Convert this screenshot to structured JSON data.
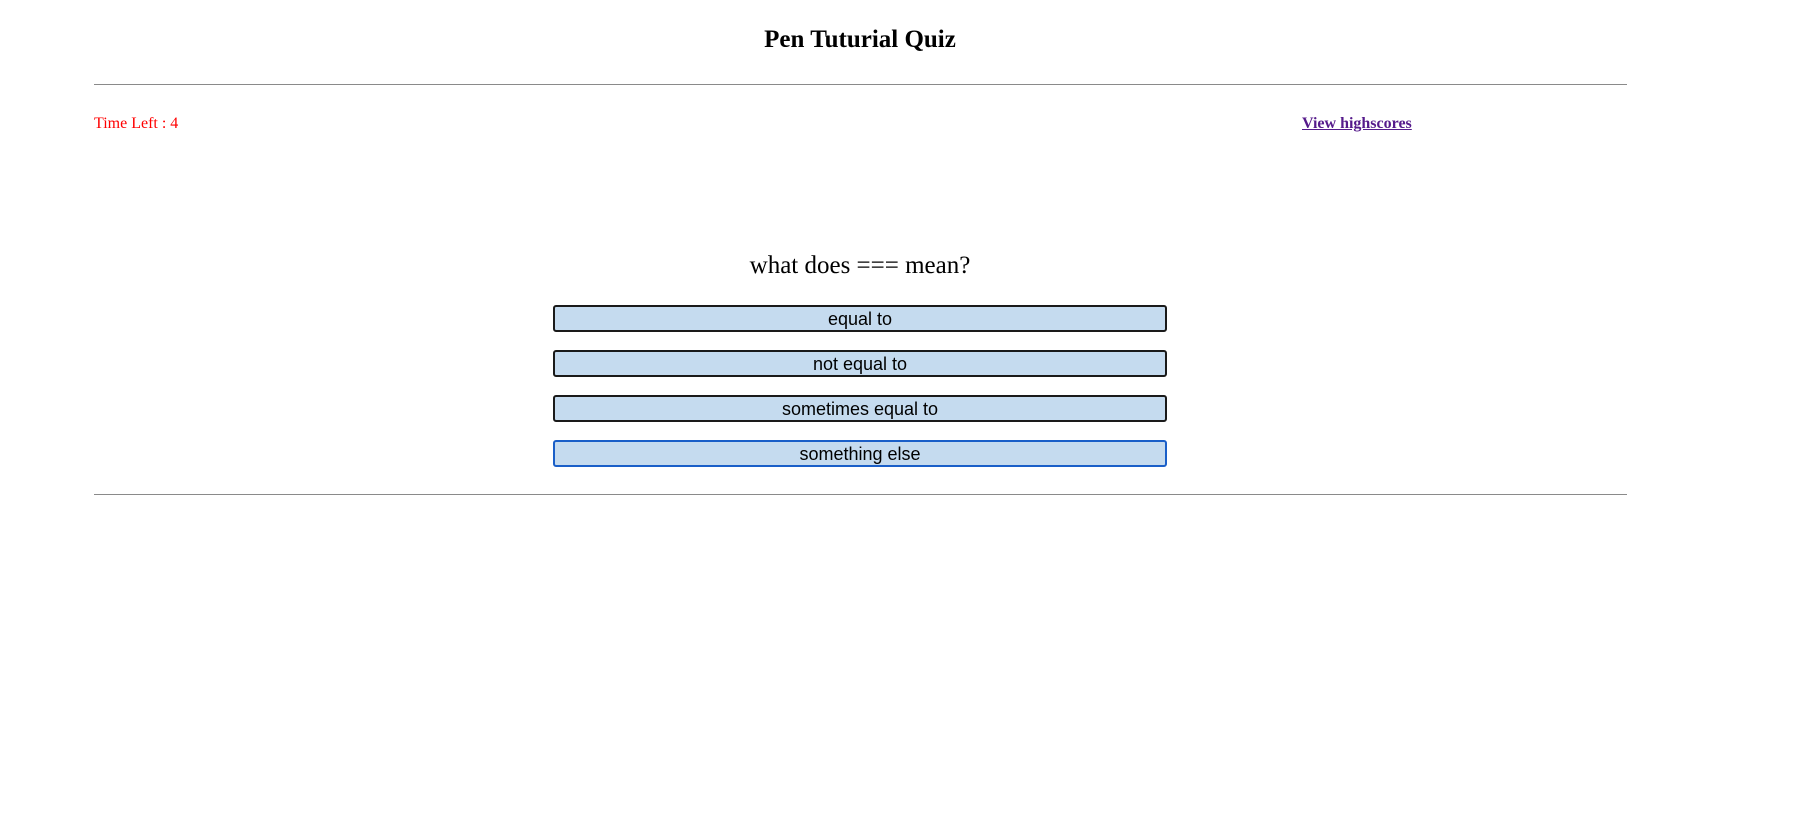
{
  "header": {
    "title": "Pen Tuturial Quiz"
  },
  "status": {
    "timer_label": "Time Left : 4",
    "highscores_link": "View highscores"
  },
  "quiz": {
    "question": "what does === mean?",
    "answers": [
      {
        "label": "equal to"
      },
      {
        "label": "not equal to"
      },
      {
        "label": "sometimes equal to"
      },
      {
        "label": "something else",
        "focused": true
      }
    ]
  },
  "colors": {
    "timer": "#ff0000",
    "link": "#551a8b",
    "button_bg": "#c5dbef",
    "focus_border": "#1a5fc8"
  }
}
